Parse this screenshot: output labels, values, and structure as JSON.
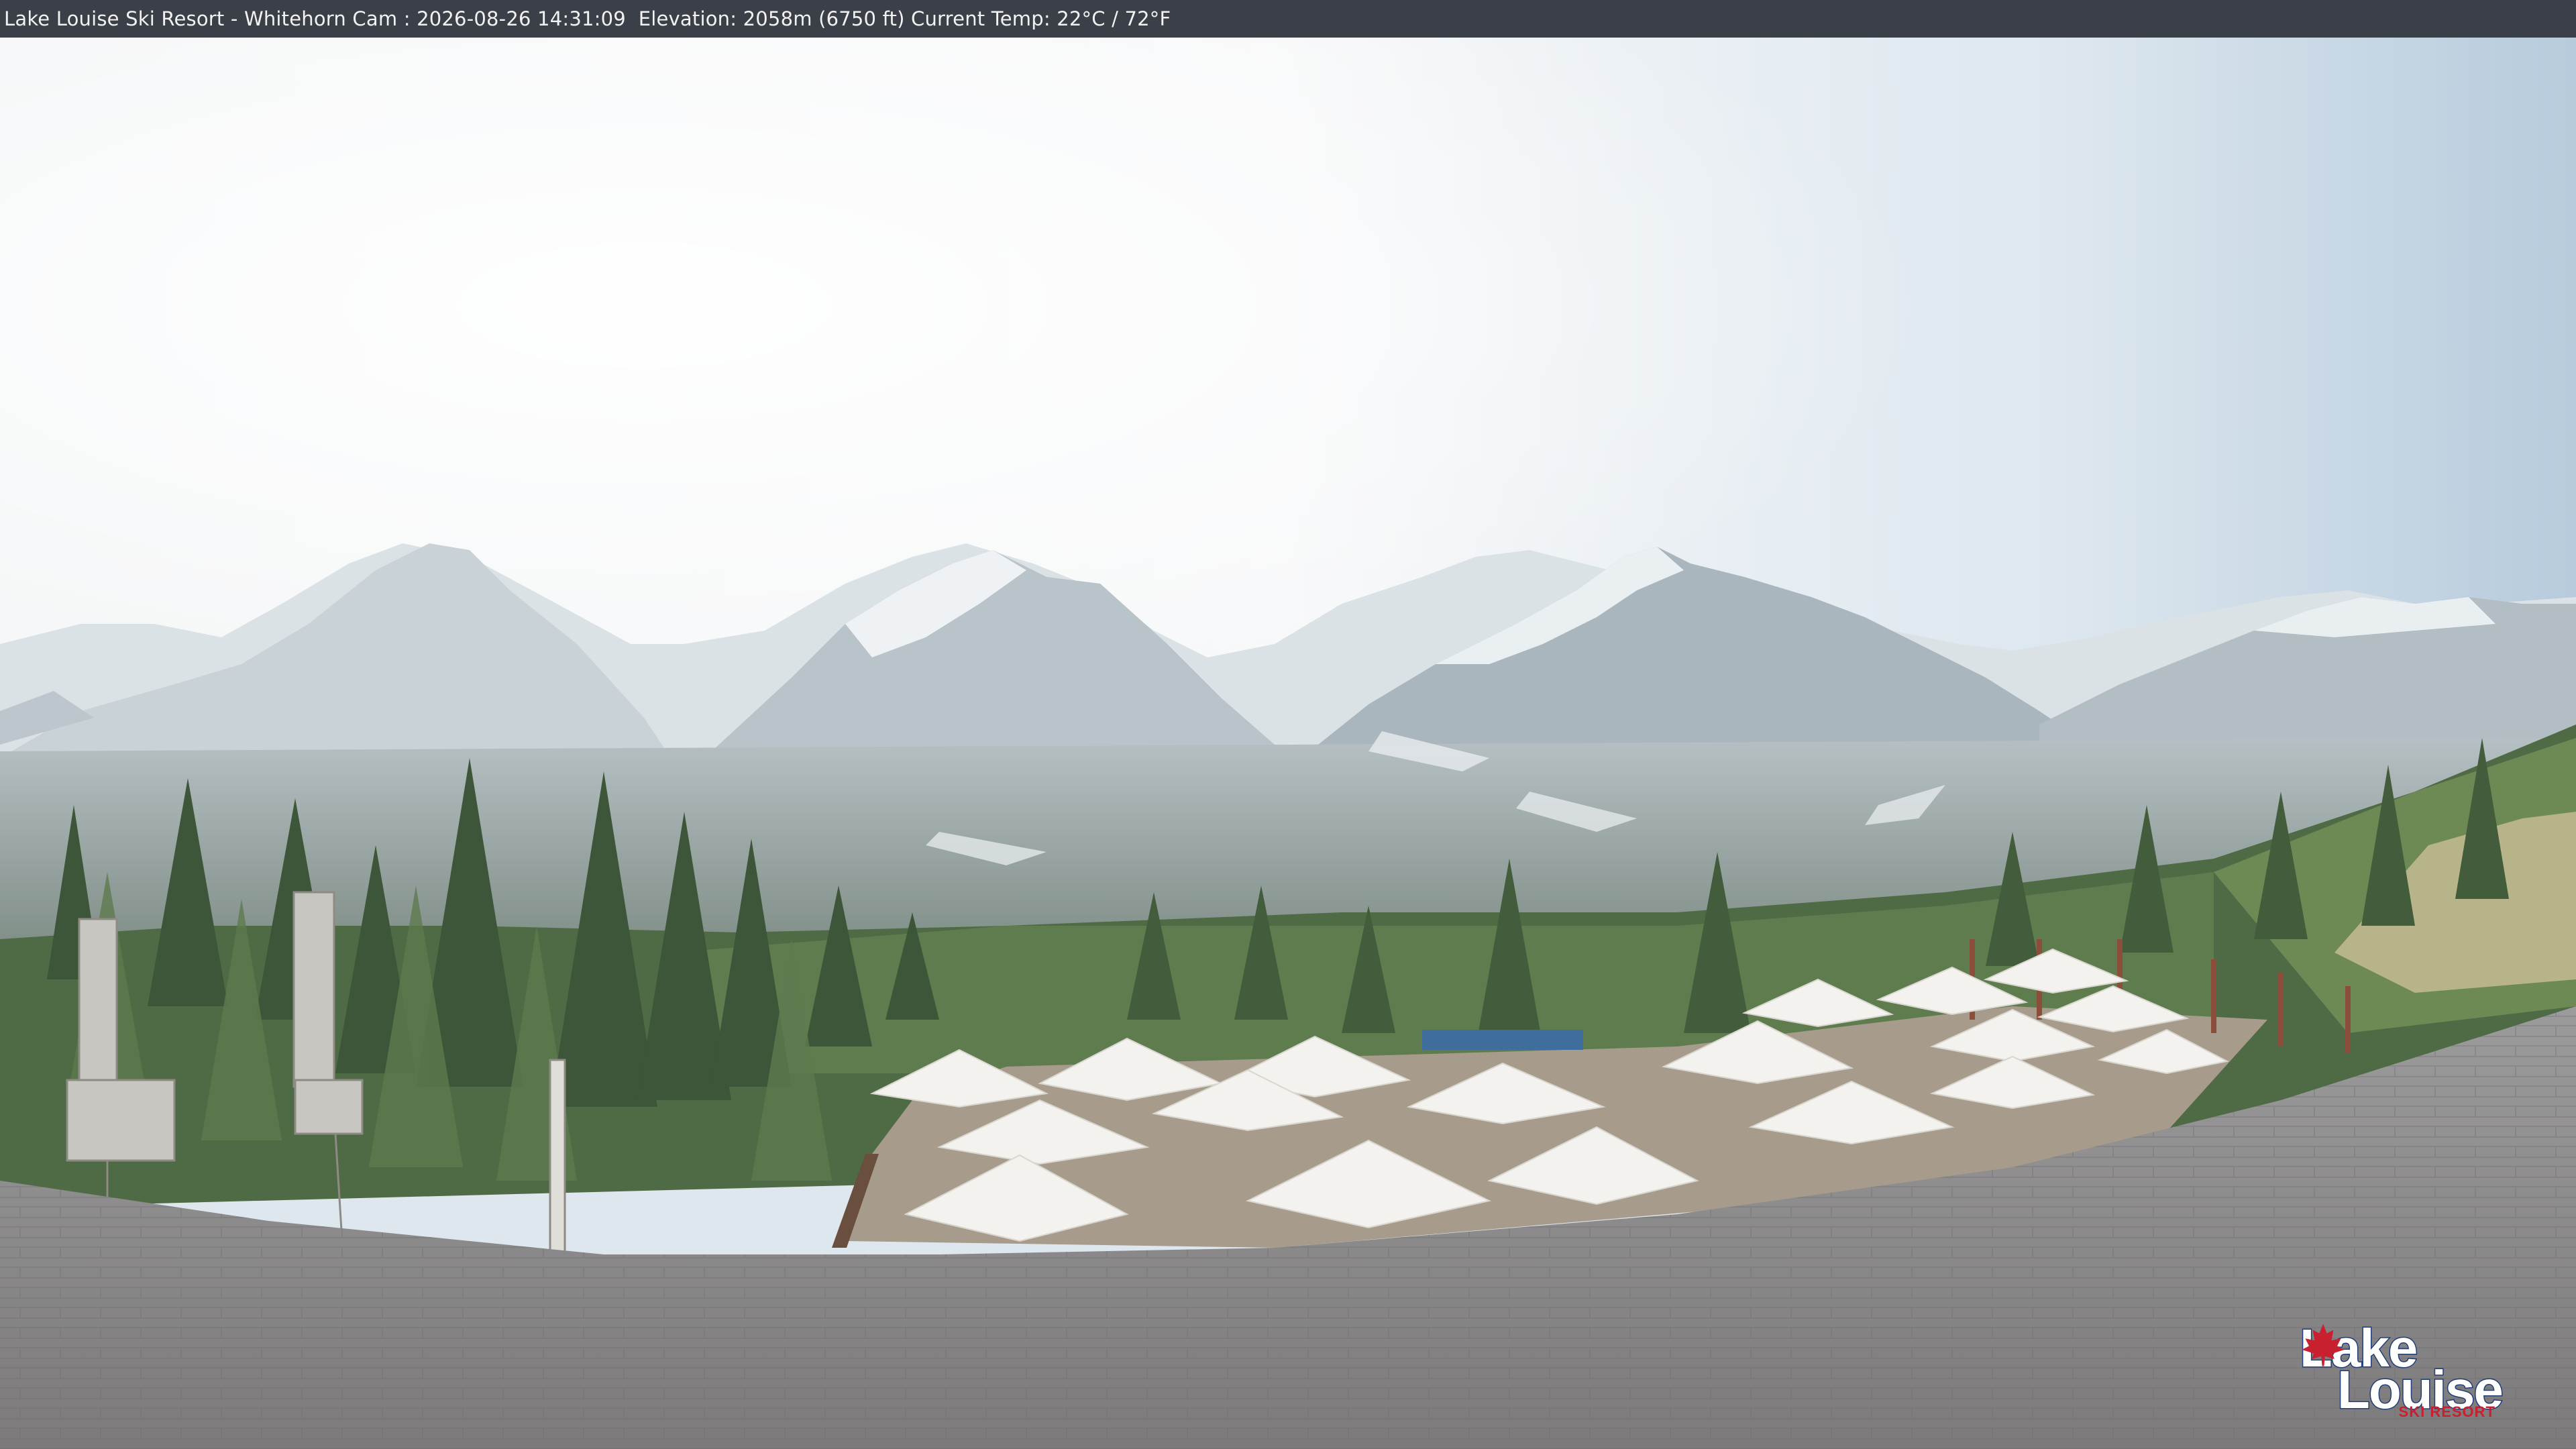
{
  "overlay": {
    "caption": "Lake Louise Ski Resort - Whitehorn Cam : 2026-08-26 14:31:09  Elevation: 2058m (6750 ft) Current Temp: 22°C / 72°F"
  },
  "logo": {
    "line1": "Lake",
    "line2": "Louise",
    "line3": "SKI RESORT",
    "leaf_icon": "maple-leaf-icon"
  },
  "colors": {
    "caption_bar": "#3b3f47",
    "logo_blue": "#1f3d7a",
    "logo_red": "#c8202f",
    "sky": "#e6eef4",
    "roof": "#8a8888"
  }
}
